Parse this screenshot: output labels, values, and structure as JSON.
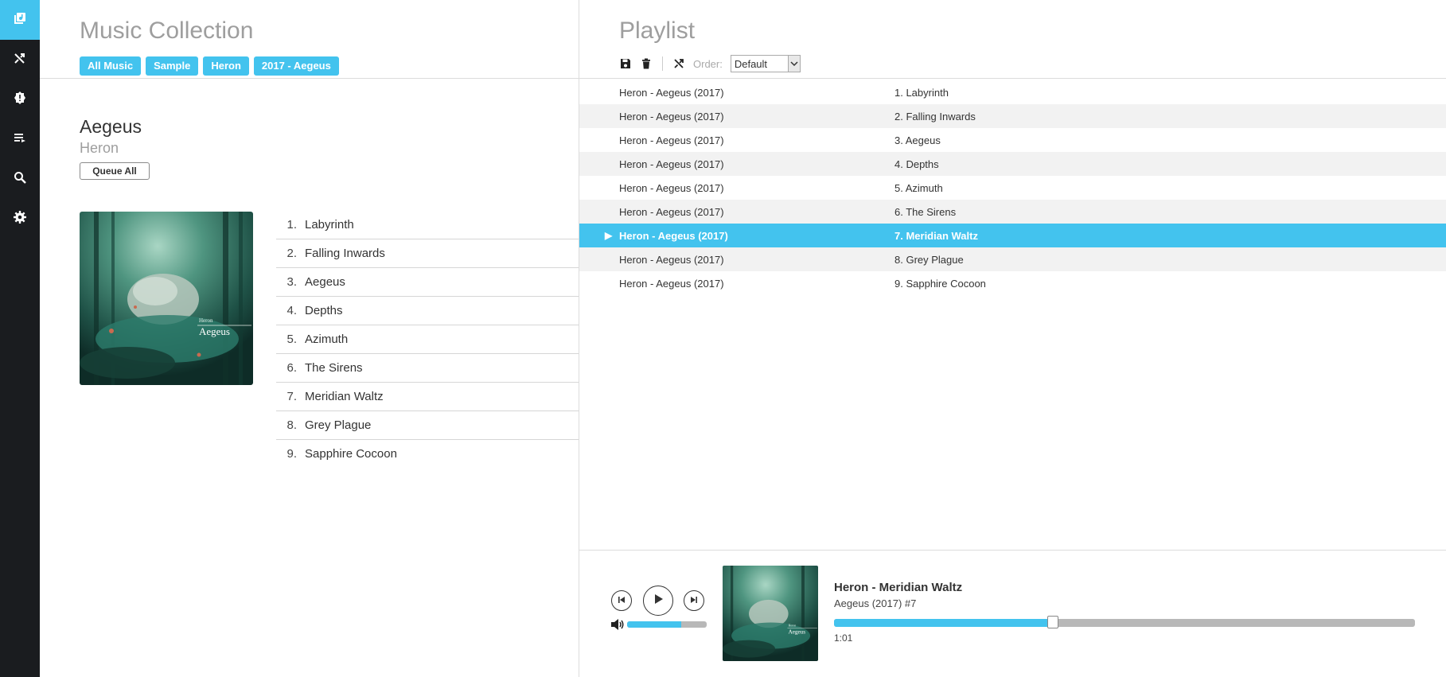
{
  "sidebar": {
    "items": [
      {
        "icon": "collection-icon",
        "active": true
      },
      {
        "icon": "shuffle-icon",
        "active": false
      },
      {
        "icon": "badge-icon",
        "active": false
      },
      {
        "icon": "playlist-icon",
        "active": false
      },
      {
        "icon": "search-icon",
        "active": false
      },
      {
        "icon": "gear-icon",
        "active": false
      }
    ]
  },
  "collection": {
    "title": "Music Collection",
    "breadcrumb": [
      "All Music",
      "Sample",
      "Heron",
      "2017 - Aegeus"
    ],
    "album": {
      "title": "Aegeus",
      "artist": "Heron",
      "queue_all_label": "Queue All",
      "cover_text_small": "Heron",
      "cover_text_large": "Aegeus"
    },
    "tracks": [
      {
        "num": "1.",
        "name": "Labyrinth"
      },
      {
        "num": "2.",
        "name": "Falling Inwards"
      },
      {
        "num": "3.",
        "name": "Aegeus"
      },
      {
        "num": "4.",
        "name": "Depths"
      },
      {
        "num": "5.",
        "name": "Azimuth"
      },
      {
        "num": "6.",
        "name": "The Sirens"
      },
      {
        "num": "7.",
        "name": "Meridian Waltz"
      },
      {
        "num": "8.",
        "name": "Grey Plague"
      },
      {
        "num": "9.",
        "name": "Sapphire Cocoon"
      }
    ]
  },
  "playlist": {
    "title": "Playlist",
    "order_label": "Order:",
    "order_value": "Default",
    "rows": [
      {
        "album": "Heron - Aegeus (2017)",
        "track": "1. Labyrinth",
        "playing": false
      },
      {
        "album": "Heron - Aegeus (2017)",
        "track": "2. Falling Inwards",
        "playing": false
      },
      {
        "album": "Heron - Aegeus (2017)",
        "track": "3. Aegeus",
        "playing": false
      },
      {
        "album": "Heron - Aegeus (2017)",
        "track": "4. Depths",
        "playing": false
      },
      {
        "album": "Heron - Aegeus (2017)",
        "track": "5. Azimuth",
        "playing": false
      },
      {
        "album": "Heron - Aegeus (2017)",
        "track": "6. The Sirens",
        "playing": false
      },
      {
        "album": "Heron - Aegeus (2017)",
        "track": "7. Meridian Waltz",
        "playing": true
      },
      {
        "album": "Heron - Aegeus (2017)",
        "track": "8. Grey Plague",
        "playing": false
      },
      {
        "album": "Heron - Aegeus (2017)",
        "track": "9. Sapphire Cocoon",
        "playing": false
      }
    ]
  },
  "player": {
    "title": "Heron - Meridian Waltz",
    "subtitle": "Aegeus (2017) #7",
    "time": "1:01",
    "progress_fraction": 0.377,
    "volume_fraction": 0.68
  },
  "colors": {
    "accent": "#43c3ee",
    "sidebar_bg": "#1a1c1f"
  }
}
